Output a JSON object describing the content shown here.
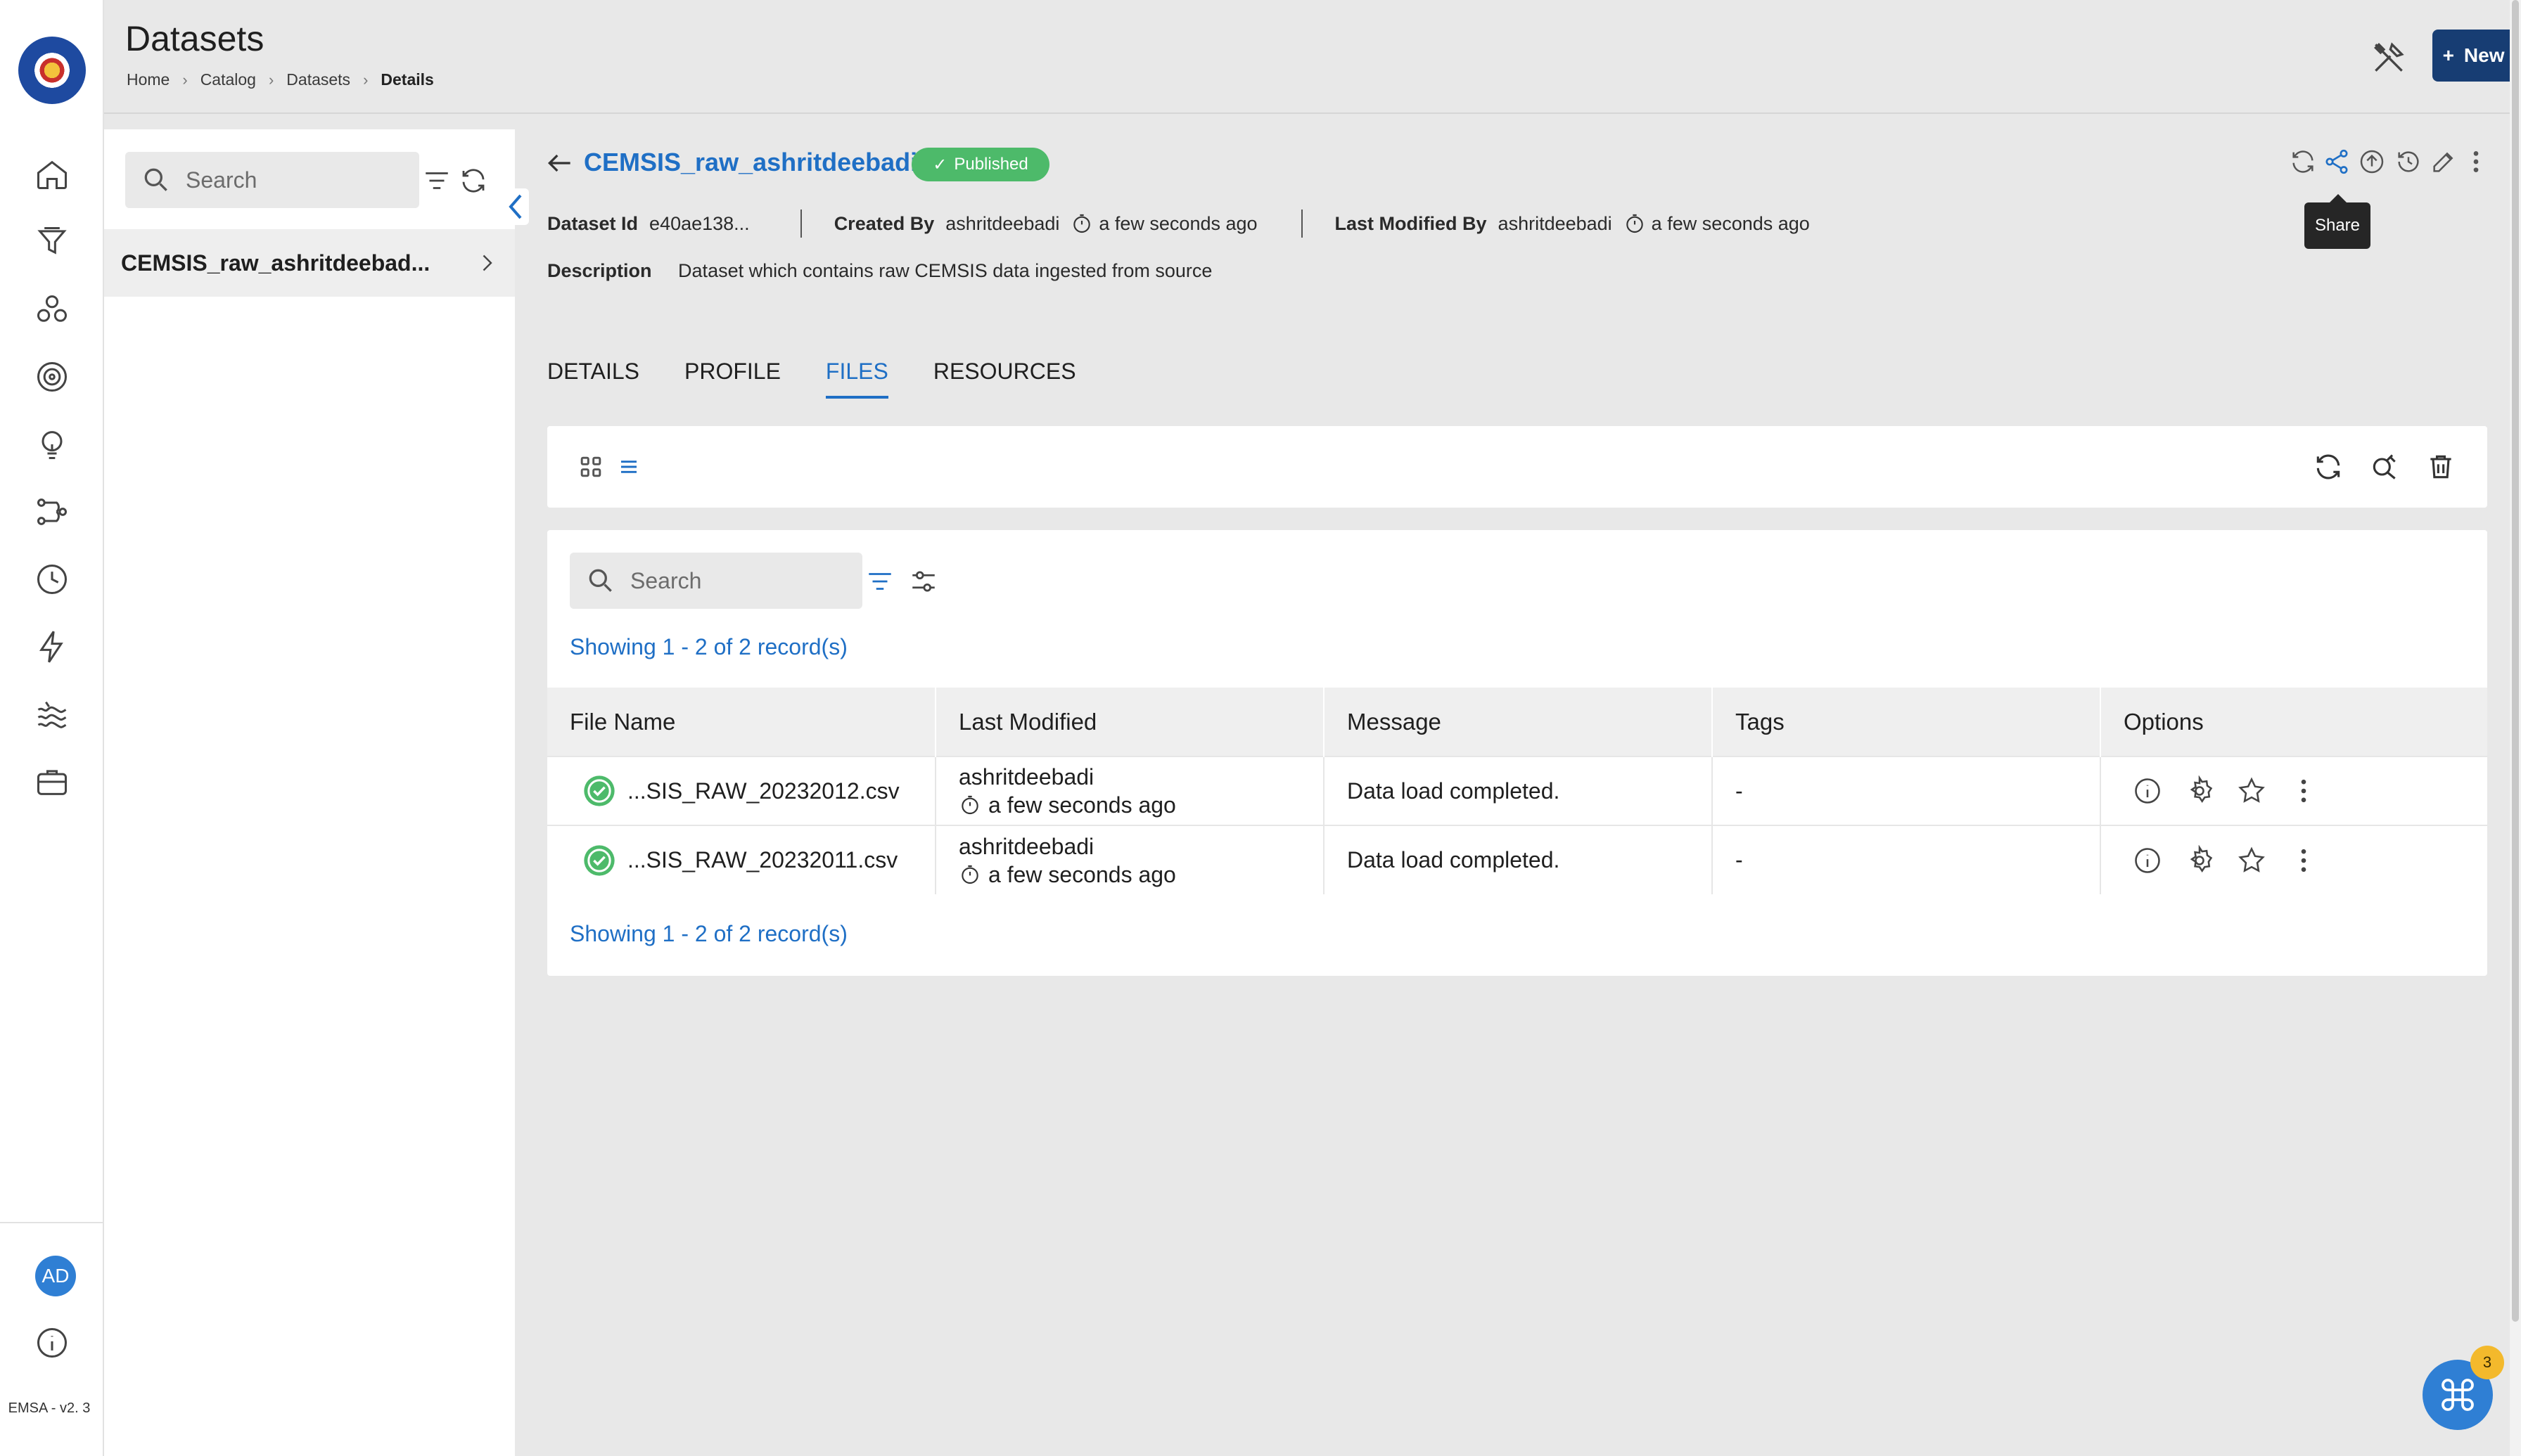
{
  "header": {
    "title": "Datasets",
    "breadcrumbs": [
      "Home",
      "Catalog",
      "Datasets",
      "Details"
    ],
    "new_button_label": "New Dataset"
  },
  "nav": {
    "avatar_initials": "AD",
    "version": "EMSA - v2. 3",
    "icons": [
      "home-icon",
      "funnel-icon",
      "cluster-icon",
      "target-icon",
      "lightbulb-icon",
      "pipeline-icon",
      "clock-icon",
      "lightning-icon",
      "water-icon",
      "briefcase-icon",
      "info-icon"
    ]
  },
  "list_panel": {
    "search_placeholder": "Search",
    "selected_item": "CEMSIS_raw_ashritdeebad..."
  },
  "dataset": {
    "name": "CEMSIS_raw_ashritdeebadi",
    "status": "Published",
    "dataset_id_label": "Dataset Id",
    "dataset_id": "e40ae138...",
    "created_by_label": "Created By",
    "created_by": "ashritdeebadi",
    "created_time": "a few seconds ago",
    "modified_by_label": "Last Modified By",
    "modified_by": "ashritdeebadi",
    "modified_time": "a few seconds ago",
    "description_label": "Description",
    "description": "Dataset which contains raw CEMSIS data ingested from source",
    "tooltip": "Share"
  },
  "tabs": [
    "DETAILS",
    "PROFILE",
    "FILES",
    "RESOURCES"
  ],
  "active_tab": "FILES",
  "files": {
    "search_placeholder": "Search",
    "showing_text": "Showing 1 - 2 of 2 record(s)",
    "columns": [
      "File Name",
      "Last Modified",
      "Message",
      "Tags",
      "Options"
    ],
    "rows": [
      {
        "file_name": "...SIS_RAW_20232012.csv",
        "modified_by": "ashritdeebadi",
        "modified_time": "a few seconds ago",
        "message": "Data load completed.",
        "tags": "-"
      },
      {
        "file_name": "...SIS_RAW_20232011.csv",
        "modified_by": "ashritdeebadi",
        "modified_time": "a few seconds ago",
        "message": "Data load completed.",
        "tags": "-"
      }
    ]
  },
  "fab": {
    "badge_count": "3"
  },
  "colors": {
    "primary": "#173d73",
    "link": "#1f6fc5",
    "published": "#4dba6a",
    "ok": "#4dba6a",
    "badge": "#f3b92c"
  }
}
